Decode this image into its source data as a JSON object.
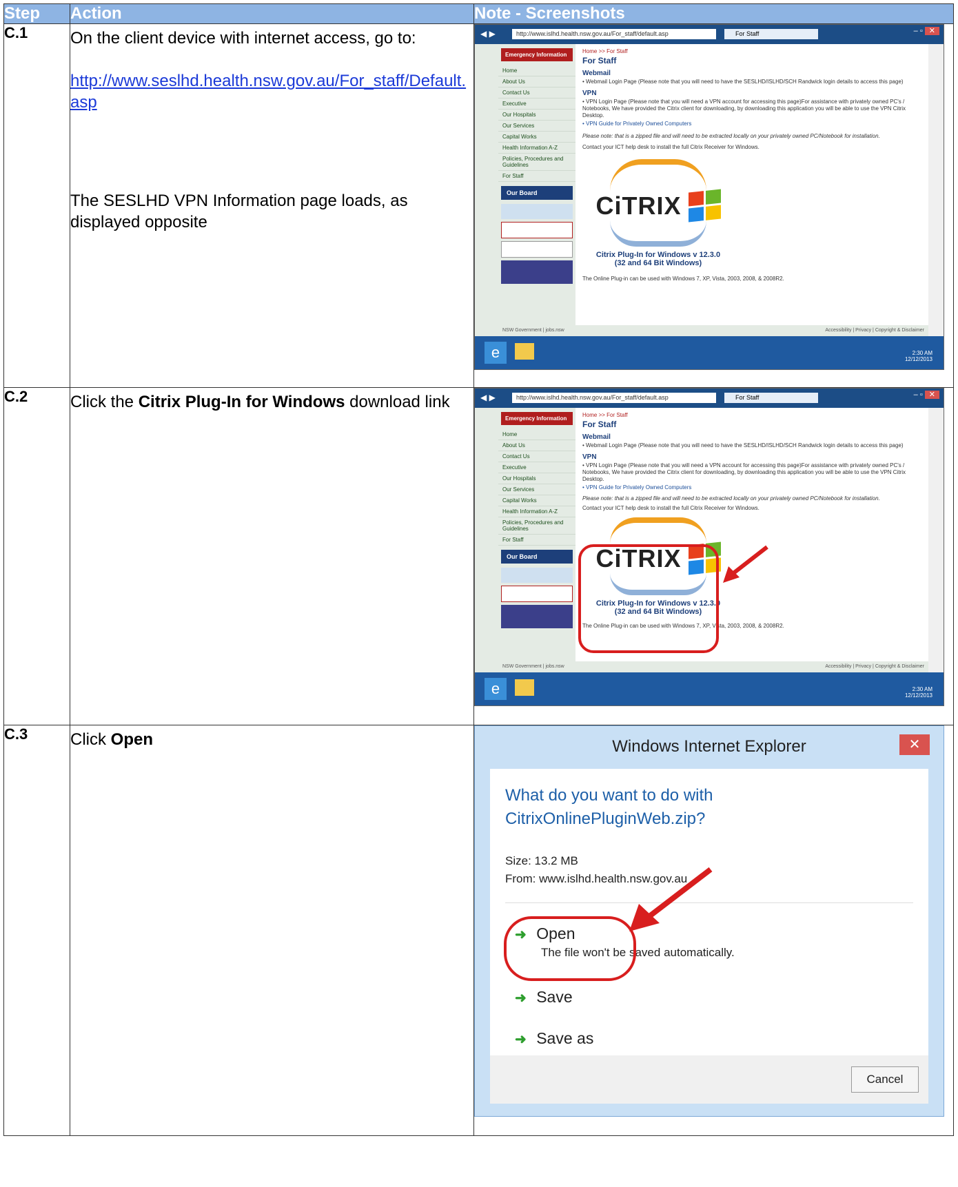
{
  "header": {
    "step": "Step",
    "action": "Action",
    "note": "Note - Screenshots"
  },
  "rows": [
    {
      "step": "C.1",
      "action_line1": "On the client device with internet access, go to:",
      "link": "http://www.seslhd.health.nsw.gov.au/For_staff/Default.asp",
      "action_line2": "The SESLHD VPN Information page loads, as displayed opposite"
    },
    {
      "step": "C.2",
      "action_prefix": "Click the ",
      "action_bold": "Citrix Plug-In for Windows",
      "action_suffix": " download link"
    },
    {
      "step": "C.3",
      "action_prefix": "Click ",
      "action_bold": "Open"
    }
  ],
  "browser": {
    "address": "http://www.islhd.health.nsw.gov.au/For_staff/default.asp",
    "tab": "For Staff",
    "emergency": "Emergency Information",
    "nav": [
      "Home",
      "About Us",
      "Contact Us",
      "Executive",
      "Our Hospitals",
      "Our Services",
      "Capital Works",
      "Health Information A-Z",
      "Policies, Procedures and Guidelines",
      "For Staff"
    ],
    "our_board": "Our Board",
    "breadcrumb": "Home >> For Staff",
    "heading": "For Staff",
    "webmail": "Webmail",
    "webmail_text": "• Webmail Login Page (Please note that you will need to have the SESLHD/ISLHD/SCH Randwick login details to access this page)",
    "vpn": "VPN",
    "vpn_text1": "• VPN Login Page (Please note that you will need a VPN account for accessing this page)For assistance with privately owned PC's / Notebooks, We have provided the Citrix client for downloading, by downloading this application you will be able to use the VPN Citrix Desktop.",
    "vpn_text2": "• VPN Guide for Privately Owned Computers",
    "note_text": "Please note: that is a zipped file and will need to be extracted locally on your privately owned PC/Notebook for installation.",
    "contact_text": "Contact your ICT help desk to install the full Citrix Receiver for Windows.",
    "citrix": "CiTRIX",
    "caption1": "Citrix Plug-In for Windows v 12.3.0",
    "caption2": "(32 and 64 Bit Windows)",
    "online_text": "The Online Plug-in can be used with Windows 7, XP, Vista, 2003, 2008, & 2008R2.",
    "footer_left": "NSW Government | jobs.nsw",
    "footer_right": "Accessibility | Privacy | Copyright & Disclaimer",
    "clock_time": "2:30 AM",
    "clock_date": "12/12/2013"
  },
  "dialog": {
    "title": "Windows Internet Explorer",
    "question": "What do you want to do with CitrixOnlinePluginWeb.zip?",
    "size": "Size: 13.2 MB",
    "from": "From: www.islhd.health.nsw.gov.au",
    "open": "Open",
    "open_sub": "The file won't be saved automatically.",
    "save": "Save",
    "save_as": "Save as",
    "cancel": "Cancel"
  },
  "colors": {
    "header_bg": "#8eb4e3",
    "link": "#1a39d8",
    "highlight": "#d81e1e",
    "arrow": "#2e9e2e"
  }
}
